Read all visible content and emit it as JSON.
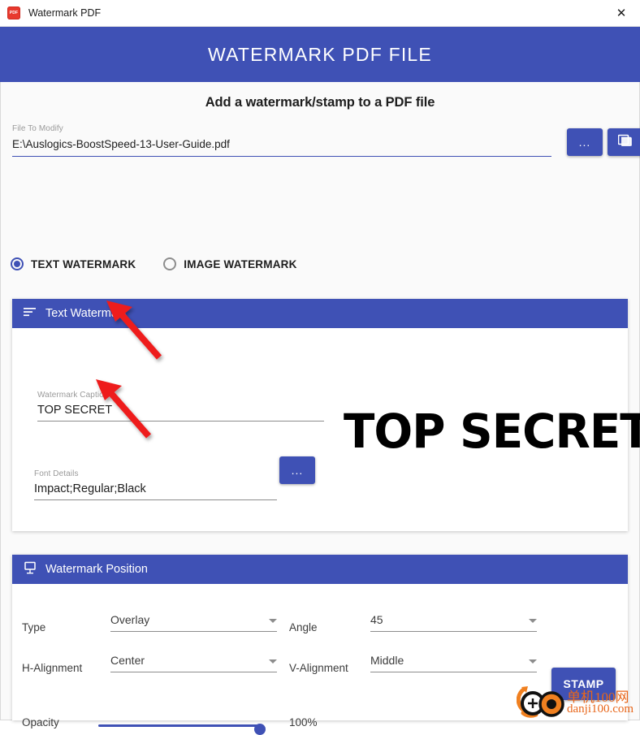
{
  "window": {
    "title": "Watermark PDF",
    "app_icon": "pdf-icon",
    "icon_text": "PDF",
    "close_label": "✕"
  },
  "banner": {
    "title": "WATERMARK PDF FILE",
    "color": "#3f51b5"
  },
  "subtitle": "Add a watermark/stamp to a PDF file",
  "file": {
    "label": "File To Modify",
    "value": "E:\\Auslogics-BoostSpeed-13-User-Guide.pdf",
    "browse_label": "...",
    "folder_icon": "folder-copy-icon"
  },
  "watermark_type": {
    "options": [
      {
        "label": "TEXT WATERMARK",
        "selected": true
      },
      {
        "label": "IMAGE WATERMARK",
        "selected": false
      }
    ]
  },
  "text_watermark": {
    "panel_title": "Text Watermark",
    "panel_icon": "text-lines-icon",
    "caption": {
      "label": "Watermark Caption",
      "value": "TOP SECRET"
    },
    "font": {
      "label": "Font Details",
      "value": "Impact;Regular;Black",
      "browse_label": "..."
    },
    "preview_text": "TOP SECRET"
  },
  "position": {
    "panel_title": "Watermark Position",
    "panel_icon": "easel-icon",
    "type": {
      "label": "Type",
      "value": "Overlay"
    },
    "angle": {
      "label": "Angle",
      "value": "45"
    },
    "h_alignment": {
      "label": "H-Alignment",
      "value": "Center"
    },
    "v_alignment": {
      "label": "V-Alignment",
      "value": "Middle"
    },
    "opacity": {
      "label": "Opacity",
      "value": "100%",
      "percent": 100
    }
  },
  "actions": {
    "stamp_label": "STAMP"
  },
  "site_watermark": {
    "text": "单机100网",
    "url": "danji100.com",
    "color": "#e8661a"
  }
}
